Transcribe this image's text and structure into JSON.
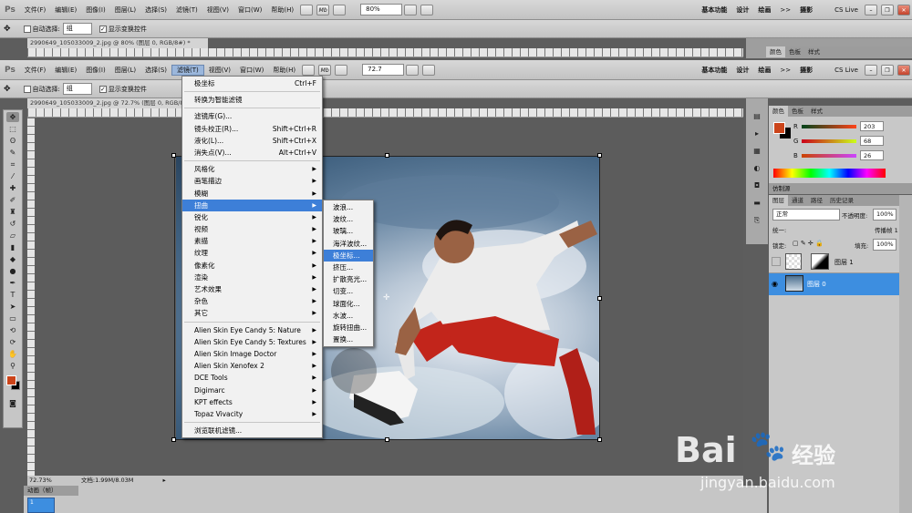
{
  "app_logo": "Ps",
  "menu": [
    "文件(F)",
    "编辑(E)",
    "图像(I)",
    "图层(L)",
    "选择(S)",
    "滤镜(T)",
    "视图(V)",
    "窗口(W)",
    "帮助(H)"
  ],
  "menubar_controls": {
    "mb_label": "Mb",
    "zoom_top": "80%",
    "zoom_front": "72.7"
  },
  "workspaces": [
    "基本功能",
    "设计",
    "绘画",
    "摄影"
  ],
  "overflow_label": ">>",
  "cslive": "CS Live",
  "options": {
    "auto_select_label": "自动选择:",
    "auto_select_value": "组",
    "show_transform": "显示变换控件"
  },
  "doc_tabs": {
    "back": "2990649_105033009_2.jpg @ 80% (图层 0, RGB/8#) *",
    "front": "2990649_105033009_2.jpg @ 72.7% (图层 0, RGB/8#)"
  },
  "filter_menu": [
    {
      "label": "极坐标",
      "shortcut": "Ctrl+F"
    },
    {
      "sep": true
    },
    {
      "label": "转换为智能滤镜"
    },
    {
      "sep": true
    },
    {
      "label": "滤镜库(G)..."
    },
    {
      "label": "镜头校正(R)...",
      "shortcut": "Shift+Ctrl+R"
    },
    {
      "label": "液化(L)...",
      "shortcut": "Shift+Ctrl+X"
    },
    {
      "label": "消失点(V)...",
      "shortcut": "Alt+Ctrl+V"
    },
    {
      "sep": true
    },
    {
      "label": "风格化",
      "sub": true
    },
    {
      "label": "画笔描边",
      "sub": true
    },
    {
      "label": "模糊",
      "sub": true
    },
    {
      "label": "扭曲",
      "sub": true,
      "hl": true
    },
    {
      "label": "锐化",
      "sub": true
    },
    {
      "label": "视频",
      "sub": true
    },
    {
      "label": "素描",
      "sub": true
    },
    {
      "label": "纹理",
      "sub": true
    },
    {
      "label": "像素化",
      "sub": true
    },
    {
      "label": "渲染",
      "sub": true
    },
    {
      "label": "艺术效果",
      "sub": true
    },
    {
      "label": "杂色",
      "sub": true
    },
    {
      "label": "其它",
      "sub": true
    },
    {
      "sep": true
    },
    {
      "label": "Alien Skin Eye Candy 5: Nature",
      "sub": true
    },
    {
      "label": "Alien Skin Eye Candy 5: Textures",
      "sub": true
    },
    {
      "label": "Alien Skin Image Doctor",
      "sub": true
    },
    {
      "label": "Alien Skin Xenofex 2",
      "sub": true
    },
    {
      "label": "DCE Tools",
      "sub": true
    },
    {
      "label": "Digimarc",
      "sub": true
    },
    {
      "label": "KPT effects",
      "sub": true
    },
    {
      "label": "Topaz Vivacity",
      "sub": true
    },
    {
      "sep": true
    },
    {
      "label": "浏览联机滤镜..."
    }
  ],
  "distort_submenu": [
    "波浪...",
    "波纹...",
    "玻璃...",
    "海洋波纹...",
    "极坐标...",
    "挤压...",
    "扩散亮光...",
    "切变...",
    "球面化...",
    "水波...",
    "旋转扭曲...",
    "置换..."
  ],
  "distort_highlight": "极坐标...",
  "color_panel": {
    "tabs": [
      "颜色",
      "色板",
      "样式"
    ],
    "r": "203",
    "g": "68",
    "b": "26",
    "r_label": "R",
    "g_label": "G",
    "b_label": "B",
    "fg": "#cb441a",
    "bg": "#000000"
  },
  "clone_tab": "仿制源",
  "layers_panel": {
    "tabs": [
      "图层",
      "通道",
      "路径",
      "历史记录"
    ],
    "blend": "正常",
    "opacity_label": "不透明度:",
    "opacity": "100%",
    "lock_label": "锁定:",
    "fill_label": "填充:",
    "fill": "100%",
    "unify_label": "统一:",
    "propagate": "传播帧 1",
    "layers": [
      {
        "name": "图层 1",
        "selected": false,
        "visible": false
      },
      {
        "name": "图层 0",
        "selected": true,
        "visible": true
      }
    ]
  },
  "status": {
    "zoom": "72.73%",
    "doc": "文档:1.99M/8.03M"
  },
  "animation": {
    "title": "动画（帧）",
    "frame": "1"
  },
  "watermark": {
    "brand": "Bai",
    "brand2": "经验",
    "url": "jingyan.baidu.com"
  },
  "photo_colors": {
    "sky_top": "#4b6f8e",
    "sky_light": "#dfe6ee",
    "shirt": "#e8e8e8",
    "shorts": "#c2251b",
    "skin": "#9a6244"
  }
}
